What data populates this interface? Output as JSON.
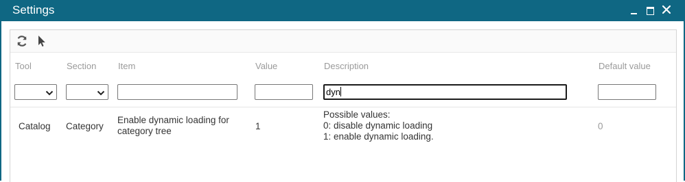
{
  "window": {
    "title": "Settings",
    "colors": {
      "titlebar": "#0f6783",
      "text": "#ffffff"
    },
    "controls": {
      "minimize": "minimize-icon",
      "maximize": "maximize-icon",
      "close": "close-icon"
    }
  },
  "toolbar": {
    "icons": [
      "refresh-icon",
      "pointer-icon"
    ]
  },
  "table": {
    "columns": [
      "Tool",
      "Section",
      "Item",
      "Value",
      "Description",
      "Default value"
    ],
    "filters": {
      "tool": "",
      "section": "",
      "item": "",
      "value": "",
      "description": "dyn",
      "default_value": ""
    },
    "rows": [
      {
        "tool": "Catalog",
        "section": "Category",
        "item_line1": "Enable dynamic loading for",
        "item_line2": "category tree",
        "value": "1",
        "description": [
          "Possible values:",
          "0: disable dynamic loading",
          "1: enable dynamic loading."
        ],
        "default_value": "0"
      }
    ]
  }
}
